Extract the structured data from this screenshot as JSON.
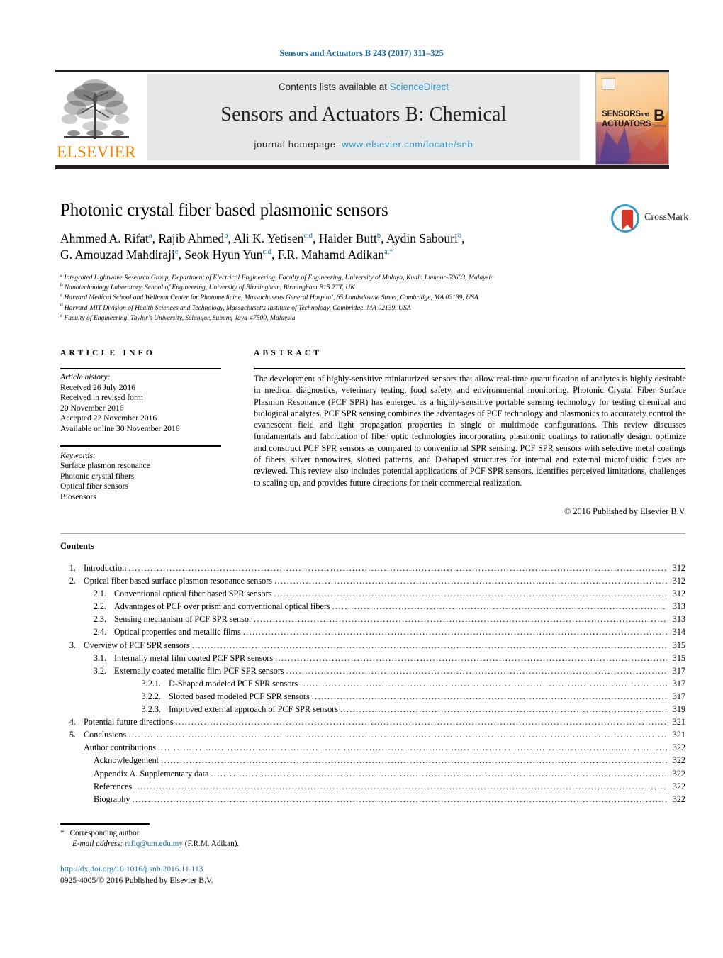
{
  "running_head": "Sensors and Actuators B 243 (2017) 311–325",
  "masthead": {
    "contents_prefix": "Contents lists available at ",
    "sciencedirect": "ScienceDirect",
    "journal_name": "Sensors and Actuators B: Chemical",
    "homepage_label": "journal homepage: ",
    "homepage_url": "www.elsevier.com/locate/snb",
    "publisher": "ELSEVIER",
    "cover": {
      "line1": "SENSORS",
      "and": "and",
      "line2": "ACTUATORS",
      "letter": "B",
      "sub": "Chemical"
    },
    "colors": {
      "link": "#2a93c9",
      "elsevier_orange": "#ef8200",
      "band_gray": "#e6e7e8",
      "rule_dark": "#231f20"
    }
  },
  "article": {
    "title": "Photonic crystal fiber based plasmonic sensors",
    "crossmark_label": "CrossMark",
    "authors_line1": "Ahmmed A. Rifat|a|, Rajib Ahmed|b|, Ali K. Yetisen|c,d|, Haider Butt|b|, Aydin Sabouri|b|,",
    "authors_line2": "G. Amouzad Mahdiraji|e|, Seok Hyun Yun|c,d|, F.R. Mahamd Adikan|a,*|",
    "affiliations": [
      {
        "mark": "a",
        "text": "Integrated Lightwave Research Group, Department of Electrical Engineering, Faculty of Engineering, University of Malaya, Kuala Lumpur-50603, Malaysia"
      },
      {
        "mark": "b",
        "text": "Nanotechnology Laboratory, School of Engineering, University of Birmingham, Birmingham B15 2TT, UK"
      },
      {
        "mark": "c",
        "text": "Harvard Medical School and Wellman Center for Photomedicine, Massachusetts General Hospital, 65 Landsdowne Street, Cambridge, MA 02139, USA"
      },
      {
        "mark": "d",
        "text": "Harvard-MIT Division of Health Sciences and Technology, Massachusetts Institute of Technology, Cambridge, MA 02139, USA"
      },
      {
        "mark": "e",
        "text": "Faculty of Engineering, Taylor's University, Selangor, Subang Jaya-47500, Malaysia"
      }
    ]
  },
  "article_info": {
    "heading": "ARTICLE INFO",
    "history_label": "Article history:",
    "history": [
      "Received 26 July 2016",
      "Received in revised form",
      "20 November 2016",
      "Accepted 22 November 2016",
      "Available online 30 November 2016"
    ],
    "keywords_label": "Keywords:",
    "keywords": [
      "Surface plasmon resonance",
      "Photonic crystal fibers",
      "Optical fiber sensors",
      "Biosensors"
    ]
  },
  "abstract": {
    "heading": "ABSTRACT",
    "body": "The development of highly-sensitive miniaturized sensors that allow real-time quantification of analytes is highly desirable in medical diagnostics, veterinary testing, food safety, and environmental monitoring. Photonic Crystal Fiber Surface Plasmon Resonance (PCF SPR) has emerged as a highly-sensitive portable sensing technology for testing chemical and biological analytes. PCF SPR sensing combines the advantages of PCF technology and plasmonics to accurately control the evanescent field and light propagation properties in single or multimode configurations. This review discusses fundamentals and fabrication of fiber optic technologies incorporating plasmonic coatings to rationally design, optimize and construct PCF SPR sensors as compared to conventional SPR sensing. PCF SPR sensors with selective metal coatings of fibers, silver nanowires, slotted patterns, and D-shaped structures for internal and external microfluidic flows are reviewed. This review also includes potential applications of PCF SPR sensors, identifies perceived limitations, challenges to scaling up, and provides future directions for their commercial realization.",
    "copyright": "© 2016 Published by Elsevier B.V."
  },
  "contents": {
    "heading": "Contents",
    "entries": [
      {
        "level": 1,
        "num": "1.",
        "label": "Introduction",
        "page": "312"
      },
      {
        "level": 1,
        "num": "2.",
        "label": "Optical fiber based surface plasmon resonance sensors",
        "page": "312"
      },
      {
        "level": 2,
        "num": "2.1.",
        "label": "Conventional optical fiber based SPR sensors",
        "page": "312"
      },
      {
        "level": 2,
        "num": "2.2.",
        "label": "Advantages of PCF over prism and conventional optical fibers",
        "page": "313"
      },
      {
        "level": 2,
        "num": "2.3.",
        "label": "Sensing mechanism of PCF SPR sensor",
        "page": "313"
      },
      {
        "level": 2,
        "num": "2.4.",
        "label": "Optical properties and metallic films",
        "page": "314"
      },
      {
        "level": 1,
        "num": "3.",
        "label": "Overview of PCF SPR sensors",
        "page": "315"
      },
      {
        "level": 2,
        "num": "3.1.",
        "label": "Internally metal film coated PCF SPR sensors",
        "page": "315"
      },
      {
        "level": 2,
        "num": "3.2.",
        "label": "Externally coated metallic film PCF SPR sensors",
        "page": "317"
      },
      {
        "level": 3,
        "num": "3.2.1.",
        "label": "D-Shaped modeled PCF SPR sensors",
        "page": "317"
      },
      {
        "level": 3,
        "num": "3.2.2.",
        "label": "Slotted based modeled PCF SPR sensors",
        "page": "317"
      },
      {
        "level": 3,
        "num": "3.2.3.",
        "label": "Improved external approach of PCF SPR sensors",
        "page": "319"
      },
      {
        "level": 1,
        "num": "4.",
        "label": "Potential future directions",
        "page": "321"
      },
      {
        "level": 1,
        "num": "5.",
        "label": "Conclusions",
        "page": "321"
      },
      {
        "level": 4,
        "num": "",
        "label": "Author contributions",
        "page": "322"
      },
      {
        "level": 5,
        "num": "",
        "label": "Acknowledgement",
        "page": "322"
      },
      {
        "level": 5,
        "num": "",
        "label": "Appendix A.    Supplementary data",
        "page": "322"
      },
      {
        "level": 5,
        "num": "",
        "label": "References",
        "page": "322"
      },
      {
        "level": 5,
        "num": "",
        "label": "Biography",
        "page": "322"
      }
    ]
  },
  "footnote": {
    "star": "*",
    "corresponding": "Corresponding author.",
    "email_label": "E-mail address:",
    "email": "rafiq@um.edu.my",
    "email_owner": "(F.R.M. Adikan)."
  },
  "footer": {
    "doi": "http://dx.doi.org/10.1016/j.snb.2016.11.113",
    "issn_line": "0925-4005/© 2016 Published by Elsevier B.V."
  }
}
